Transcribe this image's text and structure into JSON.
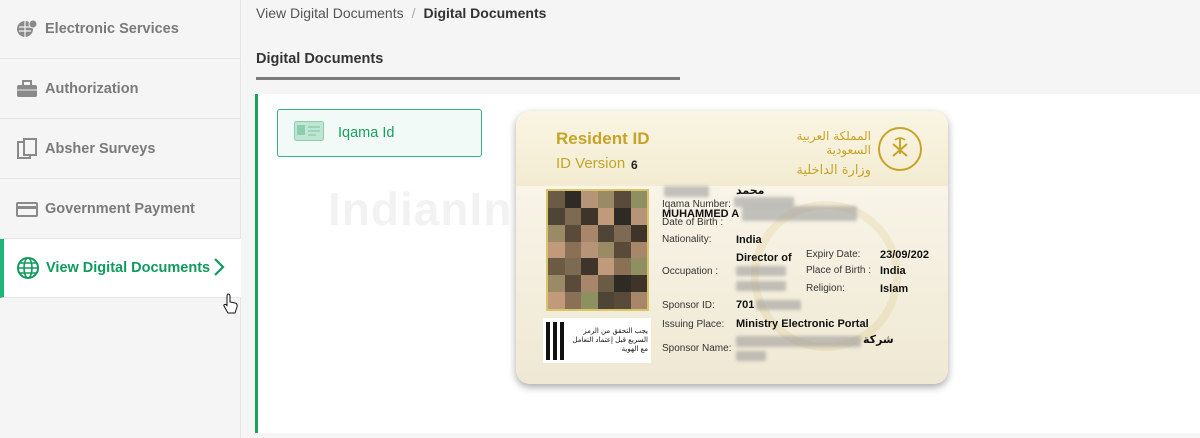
{
  "sidebar": {
    "items": [
      {
        "label": "Electronic Services",
        "icon": "globe-gear-icon"
      },
      {
        "label": "Authorization",
        "icon": "briefcase-icon"
      },
      {
        "label": "Absher Surveys",
        "icon": "clipboard-icon"
      },
      {
        "label": "Government Payment",
        "icon": "card-icon"
      },
      {
        "label": "View Digital Documents",
        "icon": "globe-icon",
        "active": true
      }
    ]
  },
  "breadcrumb": {
    "parent": "View Digital Documents",
    "separator": "/",
    "current": "Digital Documents"
  },
  "tabs": {
    "active": "Digital Documents"
  },
  "documents": {
    "iqama_button": "Iqama Id"
  },
  "watermark": "IndianIn",
  "card": {
    "title": "Resident ID",
    "version_label": "ID Version",
    "version_number": "6",
    "arabic_kingdom": "المملكة العربية السعودية",
    "arabic_ministry": "وزارة الداخلية",
    "name_arabic": "محمد",
    "iqama_label": "Iqama Number:",
    "name_english": "MUHAMMED A",
    "dob_label": "Date of Birth :",
    "nationality_label": "Nationality:",
    "nationality_value": "India",
    "occupation_label": "Occupation :",
    "occupation_value": "Director of",
    "expiry_label": "Expiry Date:",
    "expiry_value": "23/09/202",
    "pob_label": "Place of Birth :",
    "pob_value": "India",
    "religion_label": "Religion:",
    "religion_value": "Islam",
    "sponsor_id_label": "Sponsor ID:",
    "sponsor_id_value": "701",
    "issuing_label": "Issuing Place:",
    "issuing_value": "Ministry Electronic Portal",
    "sponsor_name_label": "Sponsor Name:",
    "sponsor_name_arabic": "شركة",
    "qr_text": "يجب التحقق من الرمز السريع قبل إعتماد التعامل مع الهوية"
  },
  "colors": {
    "accent": "#19a060",
    "gold": "#c6a42a"
  }
}
